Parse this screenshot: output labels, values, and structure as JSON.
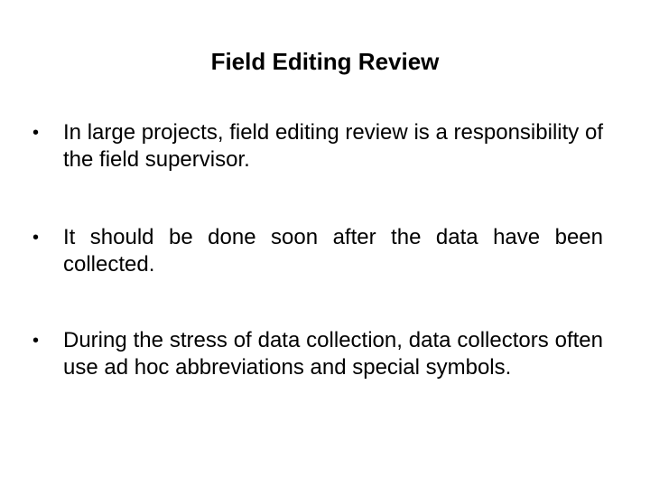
{
  "slide": {
    "title": "Field Editing Review",
    "bullet_glyph": "•",
    "bullets": [
      {
        "text": "In large projects, field editing review is a responsibility of the field supervisor."
      },
      {
        "text": "It should be done soon after the data have been collected."
      },
      {
        "text": "During the stress of data collection, data collectors often use ad hoc abbreviations and special symbols."
      }
    ]
  }
}
